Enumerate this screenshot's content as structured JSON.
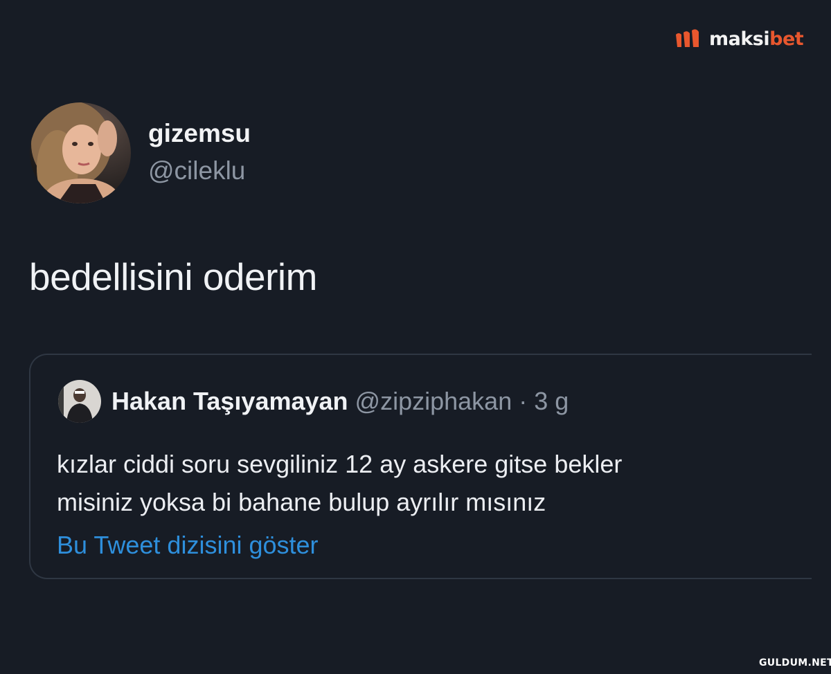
{
  "watermark": {
    "logo_icon": "maksibet-logo-icon",
    "text_part1": "maksi",
    "text_part2": "bet",
    "accent_color": "#e8572e"
  },
  "tweet": {
    "author_name": "gizemsu",
    "author_handle": "@cileklu",
    "text": "bedellisini oderim"
  },
  "quoted_tweet": {
    "author_name": "Hakan Taşıyamayan",
    "author_handle": "@zipziphakan",
    "separator": " · ",
    "time": "3 g",
    "body_line1": "kızlar ciddi soru sevgiliniz 12 ay askere gitse bekler",
    "body_line2": "misiniz yoksa bi bahane bulup ayrılır mısınız",
    "show_thread_link": "Bu Tweet dizisini göster",
    "link_color": "#2e8fdc"
  },
  "footer": {
    "site_watermark": "GULDUM.NET"
  }
}
